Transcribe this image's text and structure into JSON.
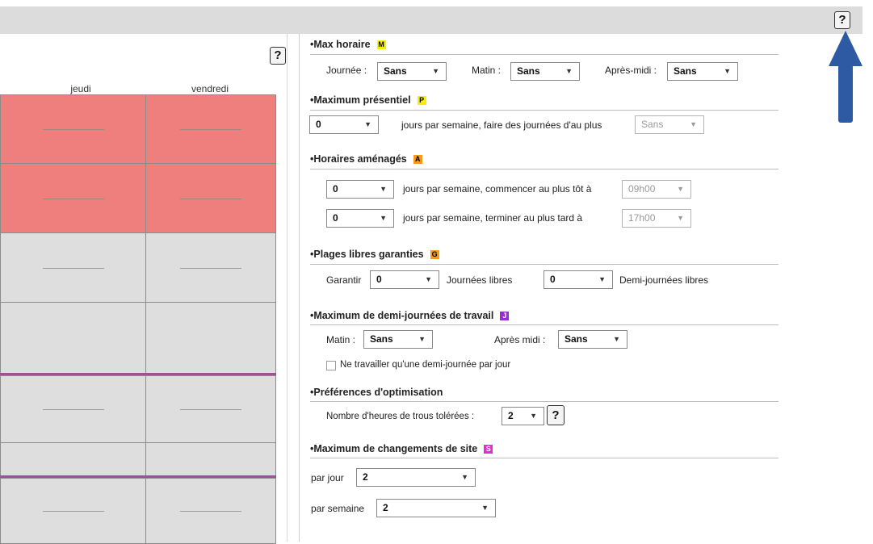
{
  "help_label": "?",
  "timetable": {
    "columns": [
      "jeudi",
      "vendredi"
    ]
  },
  "max_horaire": {
    "title": "Max horaire",
    "badge": "M",
    "badge_color": "#f5ef00",
    "journee_label": "Journée :",
    "journee_value": "Sans",
    "matin_label": "Matin :",
    "matin_value": "Sans",
    "apres_midi_label": "Après-midi :",
    "apres_midi_value": "Sans"
  },
  "max_presentiel": {
    "title": "Maximum présentiel",
    "badge": "P",
    "badge_color": "#f5ef00",
    "days_value": "0",
    "text": "jours par semaine, faire des journées d'au plus",
    "max_value": "Sans"
  },
  "horaires_amenages": {
    "title": "Horaires aménagés",
    "badge": "A",
    "badge_color": "#f59a1c",
    "row1_value": "0",
    "row1_text": "jours par semaine, commencer au plus tôt à",
    "row1_time": "09h00",
    "row2_value": "0",
    "row2_text": "jours par semaine, terminer au plus tard à",
    "row2_time": "17h00"
  },
  "plages_libres": {
    "title": "Plages libres garanties",
    "badge": "G",
    "badge_color": "#f59a1c",
    "garantir_label": "Garantir",
    "journees_value": "0",
    "journees_label": "Journées libres",
    "demi_value": "0",
    "demi_label": "Demi-journées libres"
  },
  "demi_journees": {
    "title": "Maximum de demi-journées de travail",
    "badge": "J",
    "badge_color": "#9a2cd6",
    "matin_label": "Matin :",
    "matin_value": "Sans",
    "apres_midi_label": "Après midi :",
    "apres_midi_value": "Sans",
    "checkbox_label": "Ne travailler qu'une demi-journée par jour"
  },
  "optimisation": {
    "title": "Préférences d'optimisation",
    "trous_label": "Nombre d'heures de trous tolérées :",
    "trous_value": "2"
  },
  "changements_site": {
    "title": "Maximum de changements de site",
    "badge": "S",
    "badge_color": "#e62ad8",
    "par_jour_label": "par jour",
    "par_jour_value": "2",
    "par_semaine_label": "par semaine",
    "par_semaine_value": "2"
  },
  "colors": {
    "red_cell": "#ef7f7d",
    "grey_cell": "#dedede",
    "purple_separator": "#a05098",
    "arrow": "#2e5aa4",
    "topbar": "#dcdcdc"
  },
  "icons": [
    "help-icon",
    "dropdown-arrow-icon",
    "up-arrow-annotation"
  ]
}
